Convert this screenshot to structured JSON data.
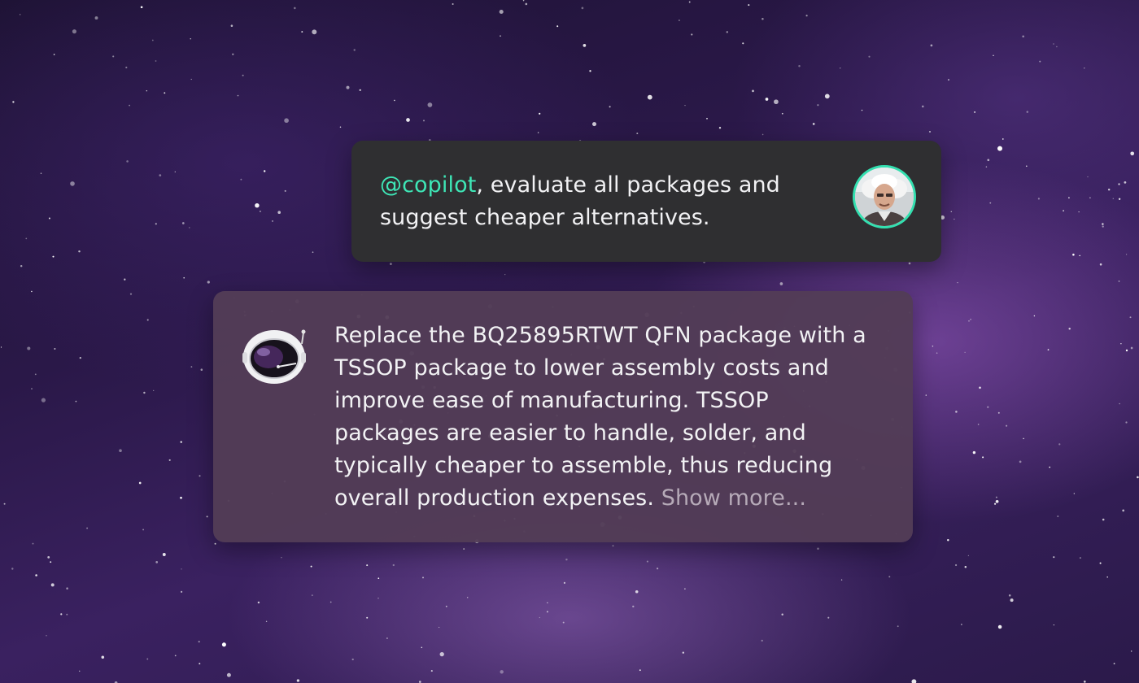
{
  "conversation": {
    "user_message": {
      "mention": "@copilot",
      "text": ", evaluate all packages and suggest cheaper alternatives.",
      "accent_color": "#3ee6b6"
    },
    "copilot_message": {
      "text": "Replace the BQ25895RTWT QFN package with a TSSOP package to lower assembly costs and improve ease of manufacturing. TSSOP packages are easier to handle, solder, and typically cheaper to assemble, thus reducing overall production expenses. ",
      "show_more_label": "Show more..."
    }
  },
  "icons": {
    "user_avatar": "user-portrait-icon",
    "copilot_avatar": "astronaut-helmet-icon"
  }
}
